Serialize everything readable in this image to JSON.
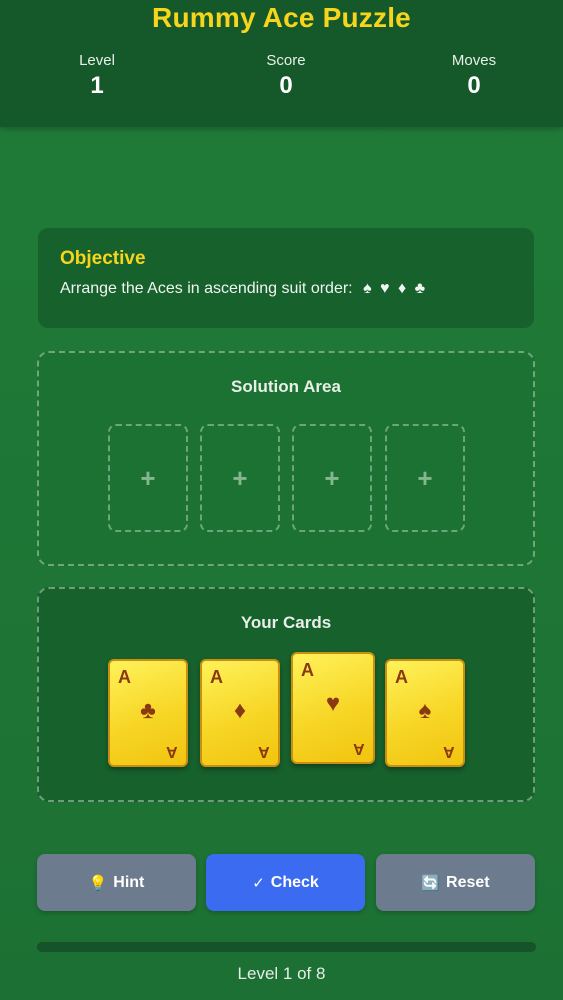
{
  "game": {
    "title": "Rummy Ace Puzzle"
  },
  "stats": {
    "level": {
      "label": "Level",
      "value": "1"
    },
    "score": {
      "label": "Score",
      "value": "0"
    },
    "moves": {
      "label": "Moves",
      "value": "0"
    }
  },
  "objective": {
    "title": "Objective",
    "text": "Arrange the Aces in ascending suit order:",
    "suits": "♠ ♥ ♦ ♣"
  },
  "solution_area": {
    "title": "Solution Area",
    "slots": [
      "+",
      "+",
      "+",
      "+"
    ]
  },
  "hand": {
    "title": "Your Cards",
    "cards": [
      {
        "rank": "A",
        "suit": "♣",
        "suit_name": "club-icon"
      },
      {
        "rank": "A",
        "suit": "♦",
        "suit_name": "diamond-icon"
      },
      {
        "rank": "A",
        "suit": "♥",
        "suit_name": "heart-icon"
      },
      {
        "rank": "A",
        "suit": "♠",
        "suit_name": "spade-icon"
      }
    ]
  },
  "buttons": {
    "hint": {
      "icon": "💡",
      "icon_name": "lightbulb-icon",
      "label": "Hint"
    },
    "check": {
      "icon": "✓",
      "icon_name": "checkmark-icon",
      "label": "Check"
    },
    "reset": {
      "icon": "🔄",
      "icon_name": "refresh-icon",
      "label": "Reset"
    }
  },
  "progress": {
    "text": "Level 1 of 8",
    "fraction": 0
  },
  "colors": {
    "accent_yellow": "#f7d51c",
    "felt_green": "#1f7a37",
    "check_blue": "#3b6bf0",
    "neutral_gray": "#6c7b8d"
  }
}
